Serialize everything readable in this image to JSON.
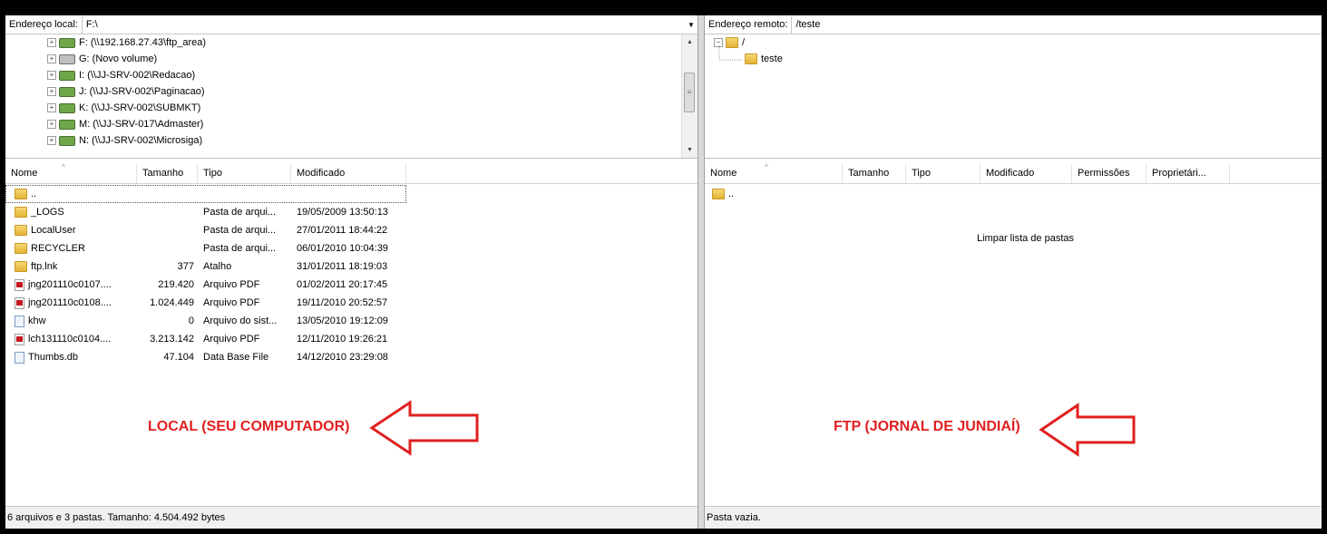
{
  "local": {
    "address_label": "Endereço local:",
    "address_value": "F:\\",
    "tree": [
      {
        "label": "F: (\\\\192.168.27.43\\ftp_area)",
        "icon": "network-drive-icon"
      },
      {
        "label": "G: (Novo volume)",
        "icon": "hard-drive-icon"
      },
      {
        "label": "I: (\\\\JJ-SRV-002\\Redacao)",
        "icon": "network-drive-icon"
      },
      {
        "label": "J: (\\\\JJ-SRV-002\\Paginacao)",
        "icon": "network-drive-icon"
      },
      {
        "label": "K: (\\\\JJ-SRV-002\\SUBMKT)",
        "icon": "network-drive-icon"
      },
      {
        "label": "M: (\\\\JJ-SRV-017\\Admaster)",
        "icon": "network-drive-icon"
      },
      {
        "label": "N: (\\\\JJ-SRV-002\\Microsiga)",
        "icon": "network-drive-icon"
      }
    ],
    "columns": [
      "Nome",
      "Tamanho",
      "Tipo",
      "Modificado"
    ],
    "files": [
      {
        "name": "..",
        "size": "",
        "type": "",
        "modified": "",
        "icon": "folder"
      },
      {
        "name": "_LOGS",
        "size": "",
        "type": "Pasta de arqui...",
        "modified": "19/05/2009 13:50:13",
        "icon": "folder"
      },
      {
        "name": "LocalUser",
        "size": "",
        "type": "Pasta de arqui...",
        "modified": "27/01/2011 18:44:22",
        "icon": "folder"
      },
      {
        "name": "RECYCLER",
        "size": "",
        "type": "Pasta de arqui...",
        "modified": "06/01/2010 10:04:39",
        "icon": "folder"
      },
      {
        "name": "ftp.lnk",
        "size": "377",
        "type": "Atalho",
        "modified": "31/01/2011 18:19:03",
        "icon": "folder"
      },
      {
        "name": "jng201110c0107....",
        "size": "219.420",
        "type": "Arquivo PDF",
        "modified": "01/02/2011 20:17:45",
        "icon": "pdf"
      },
      {
        "name": "jng201110c0108....",
        "size": "1.024.449",
        "type": "Arquivo PDF",
        "modified": "19/11/2010 20:52:57",
        "icon": "pdf"
      },
      {
        "name": "khw",
        "size": "0",
        "type": "Arquivo do sist...",
        "modified": "13/05/2010 19:12:09",
        "icon": "system"
      },
      {
        "name": "lch131110c0104....",
        "size": "3.213.142",
        "type": "Arquivo PDF",
        "modified": "12/11/2010 19:26:21",
        "icon": "pdf"
      },
      {
        "name": "Thumbs.db",
        "size": "47.104",
        "type": "Data Base File",
        "modified": "14/12/2010 23:29:08",
        "icon": "system"
      }
    ],
    "annotation": "LOCAL (SEU COMPUTADOR)",
    "status": "6 arquivos e 3 pastas. Tamanho: 4.504.492 bytes"
  },
  "remote": {
    "address_label": "Endereço remoto:",
    "address_value": "/teste",
    "tree": [
      {
        "label": "/",
        "icon": "folder"
      },
      {
        "label": "teste",
        "icon": "folder"
      }
    ],
    "columns": [
      "Nome",
      "Tamanho",
      "Tipo",
      "Modificado",
      "Permissões",
      "Proprietári..."
    ],
    "files": [
      {
        "name": "..",
        "icon": "folder"
      }
    ],
    "center_message": "Limpar lista de pastas",
    "annotation": "FTP (JORNAL DE JUNDIAÍ)",
    "status": "Pasta vazia."
  },
  "colors": {
    "annotation": "#e02020",
    "background": "#000000"
  }
}
